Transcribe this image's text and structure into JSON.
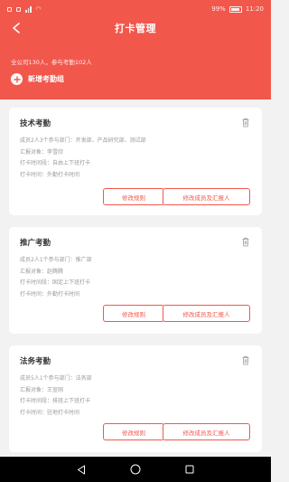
{
  "status_bar": {
    "battery": "99%",
    "time": "11:20"
  },
  "nav": {
    "title": "打卡管理"
  },
  "summary": "全公司130人，参与考勤102人",
  "add_group_label": "新增考勤组",
  "groups": [
    {
      "name": "技术考勤",
      "members": "成员2人3个参与部门：开发部、产品研究部、测试部",
      "reporter": "汇报对象：李雪欣",
      "rule": "打卡时间段：自由上下班打卡",
      "method": "打卡时间：外勤打卡时间",
      "edit_rule": "修改规则",
      "edit_members": "修改成员及汇报人"
    },
    {
      "name": "推广考勤",
      "members": "成员2人1个参与部门：推广部",
      "reporter": "汇报对象：赵腾腾",
      "rule": "打卡时间段：固定上下班打卡",
      "method": "打卡时间：外勤打卡时间",
      "edit_rule": "修改规则",
      "edit_members": "修改成员及汇报人"
    },
    {
      "name": "法务考勤",
      "members": "成员5人1个参与部门：法务部",
      "reporter": "汇报对象：王宣刚",
      "rule": "打卡时间段：排班上下班打卡",
      "method": "打卡时间：驻地打卡时间",
      "edit_rule": "修改规则",
      "edit_members": "修改成员及汇报人"
    }
  ],
  "colors": {
    "accent": "#f2574c",
    "background": "#f2f2f2"
  },
  "icons": [
    "back-icon",
    "plus-icon",
    "trash-icon",
    "nav-back-icon",
    "nav-home-icon",
    "nav-recent-icon"
  ]
}
